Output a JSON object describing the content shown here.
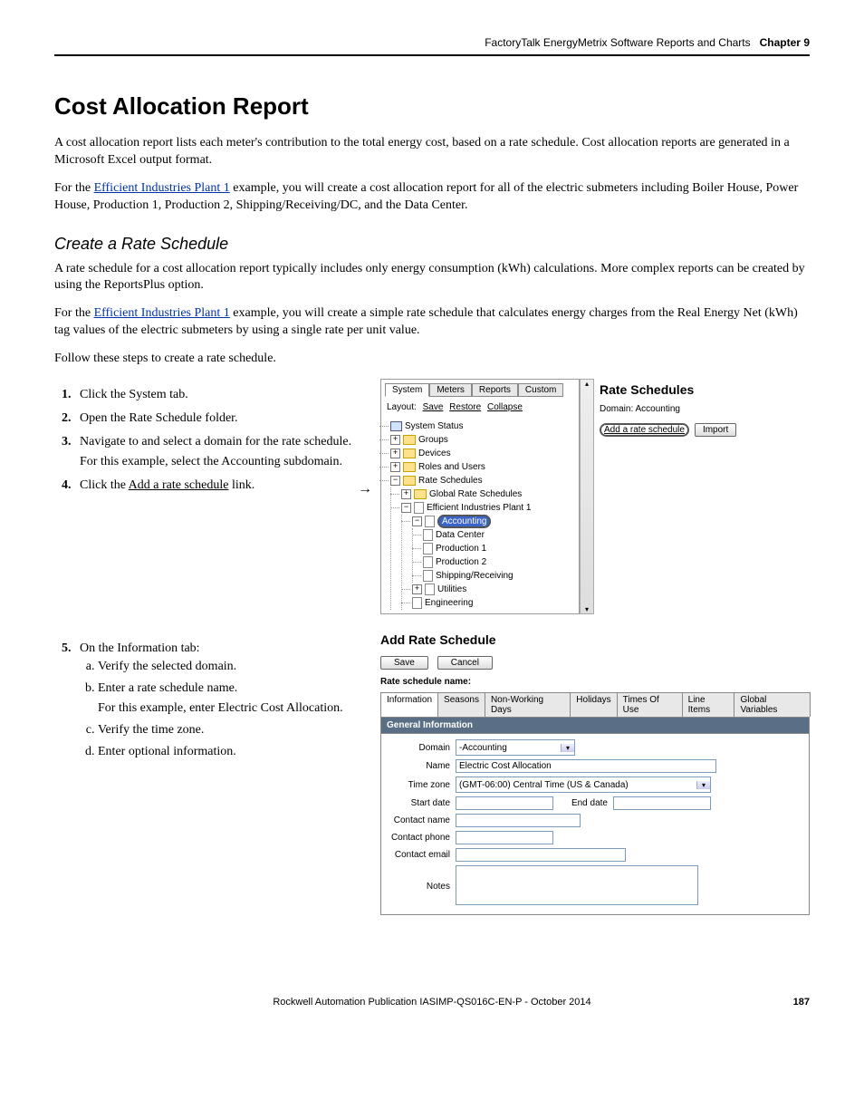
{
  "header": {
    "running": "FactoryTalk EnergyMetrix Software Reports and Charts",
    "chapter": "Chapter 9"
  },
  "title": "Cost Allocation Report",
  "p1": "A cost allocation report lists each meter's contribution to the total energy cost, based on a rate schedule. Cost allocation reports are generated in a Microsoft Excel output format.",
  "p2a": "For the ",
  "p2link": "Efficient Industries Plant 1",
  "p2b": " example, you will create a cost allocation report for all of the electric submeters including Boiler House, Power House, Production 1, Production 2, Shipping/Receiving/DC, and the Data Center.",
  "sub1": "Create a Rate Schedule",
  "p3": "A rate schedule for a cost allocation report typically includes only energy consumption (kWh) calculations. More complex reports can be created by using the ReportsPlus option.",
  "p4a": "For the ",
  "p4link": "Efficient Industries Plant 1",
  "p4b": " example, you will create a simple rate schedule that calculates energy charges from the Real Energy Net (kWh) tag values of the electric submeters by using a single rate per unit value.",
  "p5": "Follow these steps to create a rate schedule.",
  "steps": {
    "s1": "Click the System tab.",
    "s2": "Open the Rate Schedule folder.",
    "s3": "Navigate to and select a domain for the rate schedule.",
    "s3note": "For this example, select the Accounting subdomain.",
    "s4a": "Click the ",
    "s4u": "Add a rate schedule",
    "s4b": " link.",
    "s5": "On the Information tab:",
    "s5a": "Verify the selected domain.",
    "s5b": "Enter a rate schedule name.",
    "s5bnote": "For this example, enter Electric Cost Allocation.",
    "s5c": "Verify the time zone.",
    "s5d": "Enter optional information."
  },
  "shot1": {
    "tabs": [
      "System",
      "Meters",
      "Reports",
      "Custom"
    ],
    "layout_label": "Layout:",
    "layout_links": [
      "Save",
      "Restore",
      "Collapse"
    ],
    "tree": {
      "root": "System Status",
      "groups": "Groups",
      "devices": "Devices",
      "roles": "Roles and Users",
      "rate": "Rate Schedules",
      "global": "Global Rate Schedules",
      "plant": "Efficient Industries Plant 1",
      "accounting": "Accounting",
      "children": [
        "Data Center",
        "Production 1",
        "Production 2",
        "Shipping/Receiving"
      ],
      "utilities": "Utilities",
      "engineering": "Engineering"
    },
    "right_title": "Rate Schedules",
    "domain_line": "Domain: Accounting",
    "add_link": "Add a rate schedule",
    "import_btn": "Import"
  },
  "shot2": {
    "title": "Add Rate Schedule",
    "save": "Save",
    "cancel": "Cancel",
    "name_label": "Rate schedule name:",
    "tabs": [
      "Information",
      "Seasons",
      "Non-Working Days",
      "Holidays",
      "Times Of Use",
      "Line Items",
      "Global Variables"
    ],
    "section": "General Information",
    "fields": {
      "domain_l": "Domain",
      "domain_v": "-Accounting",
      "name_l": "Name",
      "name_v": "Electric Cost Allocation",
      "tz_l": "Time zone",
      "tz_v": "(GMT-06:00) Central Time (US & Canada)",
      "start_l": "Start date",
      "end_l": "End date",
      "cname_l": "Contact name",
      "cphone_l": "Contact phone",
      "cemail_l": "Contact email",
      "notes_l": "Notes"
    }
  },
  "footer": {
    "pub": "Rockwell Automation Publication IASIMP-QS016C-EN-P - October 2014",
    "page": "187"
  }
}
